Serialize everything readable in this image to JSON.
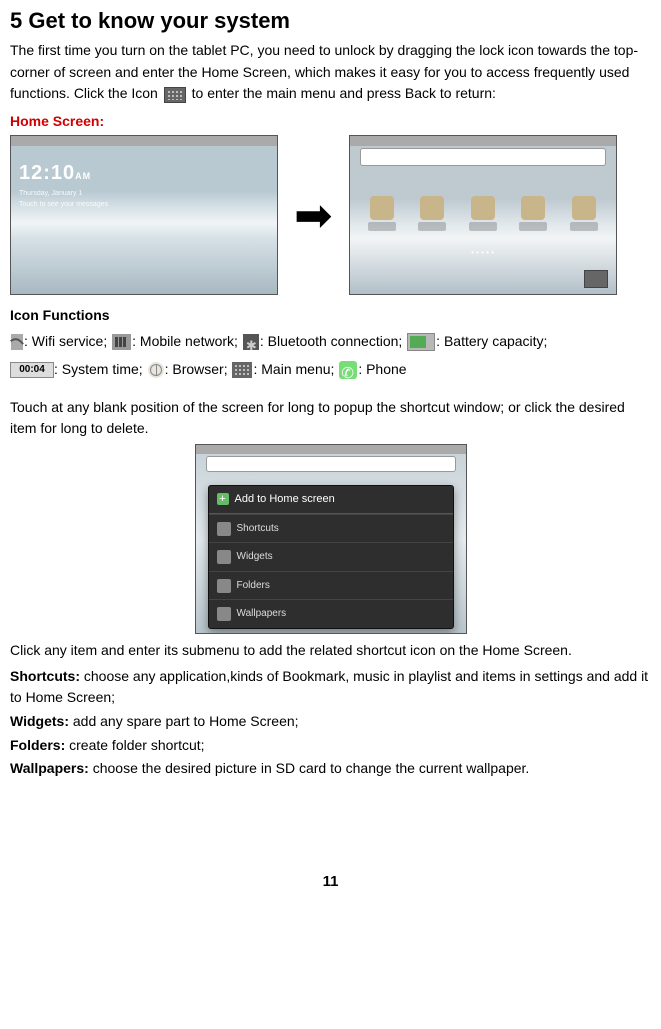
{
  "section": {
    "number": "5",
    "title": "Get to know your system"
  },
  "intro": "The first time you turn on the tablet PC, you need to unlock by dragging the lock icon towards the top-corner of screen and enter the Home Screen, which makes it easy for you to access frequently used functions. Click the Icon",
  "intro_tail": "to enter the main menu and press Back to return:",
  "home_screen_label": "Home Screen:",
  "lock": {
    "time": "12:10",
    "ampm": "AM",
    "day": "Thursday, January 1",
    "hint": "Touch to see your messages"
  },
  "icon_functions_label": "Icon Functions",
  "icons": {
    "wifi": ": Wifi service;",
    "mobile": ": Mobile network;",
    "bt": ": Bluetooth connection;",
    "batt": ": Battery capacity;",
    "time_value": "00:04",
    "time": ": System time;",
    "browser": ": Browser;",
    "menu": ": Main menu;",
    "phone": ": Phone"
  },
  "touch_note": "Touch at any blank position of the screen for long to popup the shortcut window; or click the desired item for long to delete.",
  "popup": {
    "header": "Add to Home screen",
    "rows": [
      "Shortcuts",
      "Widgets",
      "Folders",
      "Wallpapers"
    ]
  },
  "submenu_note": "Click any item and enter its submenu to add the related shortcut icon on the Home Screen.",
  "defs": {
    "shortcuts_label": "Shortcuts:",
    "shortcuts_text": " choose any application,kinds of Bookmark, music in playlist and items in settings and add it to Home Screen;",
    "widgets_label": "Widgets:",
    "widgets_text": " add any spare part to Home Screen;",
    "folders_label": "Folders:",
    "folders_text": " create folder shortcut;",
    "wallpapers_label": "Wallpapers:",
    "wallpapers_text": " choose the desired picture in SD card to change the current wallpaper."
  },
  "page_number": "11"
}
